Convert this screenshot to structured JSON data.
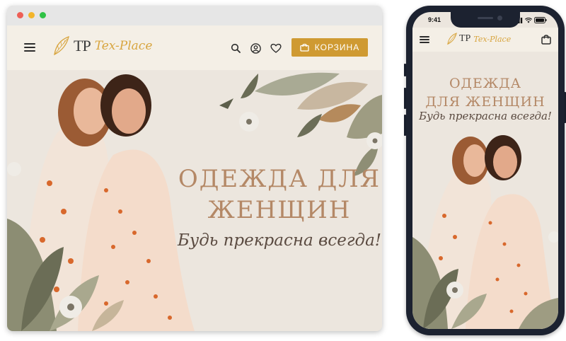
{
  "desktop": {
    "window_dots": [
      "close",
      "minimize",
      "maximize"
    ],
    "brand": {
      "monogram": "TP",
      "name": "Tex-Place"
    },
    "header_icons": [
      "menu-icon",
      "search-icon",
      "user-icon",
      "heart-icon"
    ],
    "cart_label": "КОРЗИНА",
    "hero": {
      "title_line1": "ОДЕЖДА ДЛЯ",
      "title_line2": "ЖЕНЩИН",
      "subtitle": "Будь прекрасна всегда!"
    }
  },
  "mobile": {
    "status_time": "9:41",
    "brand": {
      "monogram": "TP",
      "name": "Tex-Place"
    },
    "header_icons": [
      "menu-icon",
      "shopping-bag-icon"
    ],
    "hero": {
      "title_line1": "ОДЕЖДА",
      "title_line2": "ДЛЯ ЖЕНЩИН",
      "subtitle": "Будь прекрасна всегда!"
    }
  },
  "colors": {
    "accent": "#cf9a32",
    "title": "#b48866",
    "header_bg": "#f4efe6",
    "hero_bg": "#ece6de",
    "phone_body": "#1c2230"
  }
}
